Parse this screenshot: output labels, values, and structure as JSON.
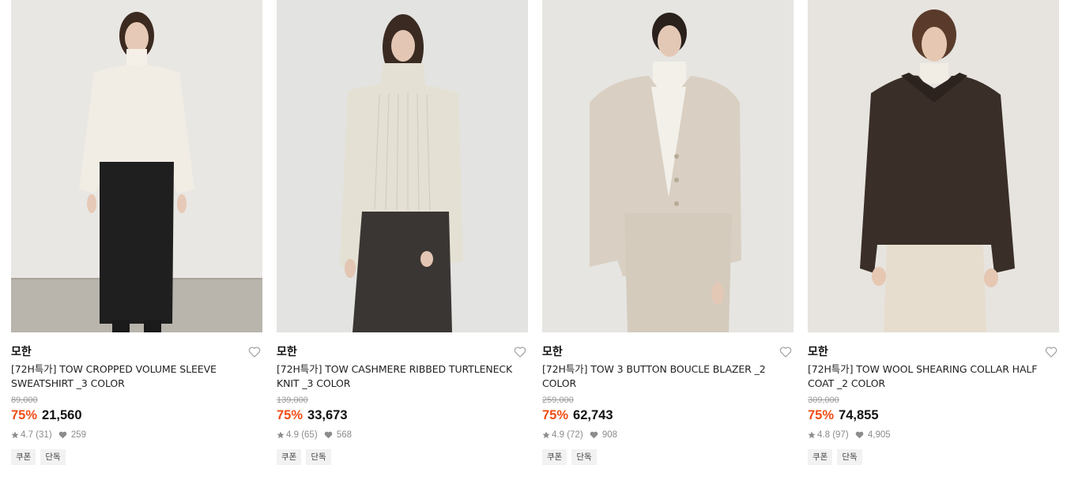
{
  "products": [
    {
      "brand": "모한",
      "title": "[72H특가] TOW CROPPED VOLUME SLEEVE SWEATSHIRT _3 COLOR",
      "original_price": "89,000",
      "discount": "75%",
      "price": "21,560",
      "rating": "4.7",
      "reviews": "(31)",
      "likes": "259",
      "tags": [
        "쿠폰",
        "단독"
      ],
      "image_palette": {
        "bg": "#e9e7e3",
        "floor": "#b9b4ac",
        "top": "#f1ede4",
        "bottom": "#1f1f1f",
        "hair": "#3c2a20",
        "skin": "#e6c9b6"
      }
    },
    {
      "brand": "모한",
      "title": "[72H특가] TOW CASHMERE RIBBED TURTLENECK KNIT _3 COLOR",
      "original_price": "139,000",
      "discount": "75%",
      "price": "33,673",
      "rating": "4.9",
      "reviews": "(65)",
      "likes": "568",
      "tags": [
        "쿠폰",
        "단독"
      ],
      "image_palette": {
        "bg": "#e3e3e1",
        "floor": "#e3e3e1",
        "top": "#e4e0d3",
        "bottom": "#3a3633",
        "hair": "#3a2a22",
        "skin": "#e3c6b3"
      }
    },
    {
      "brand": "모한",
      "title": "[72H특가] TOW 3 BUTTON BOUCLE BLAZER _2 COLOR",
      "original_price": "259,000",
      "discount": "75%",
      "price": "62,743",
      "rating": "4.9",
      "reviews": "(72)",
      "likes": "908",
      "tags": [
        "쿠폰",
        "단독"
      ],
      "image_palette": {
        "bg": "#e6e5e2",
        "floor": "#e6e5e2",
        "top": "#d9d0c3",
        "bottom": "#d4cbbd",
        "hair": "#2a211c",
        "skin": "#e4c8b6"
      }
    },
    {
      "brand": "모한",
      "title": "[72H특가] TOW WOOL SHEARING COLLAR HALF COAT _2 COLOR",
      "original_price": "309,000",
      "discount": "75%",
      "price": "74,855",
      "rating": "4.8",
      "reviews": "(97)",
      "likes": "4,905",
      "tags": [
        "쿠폰",
        "단독"
      ],
      "image_palette": {
        "bg": "#e7e4df",
        "floor": "#e7e4df",
        "top": "#3a2e28",
        "bottom": "#e6ddcf",
        "hair": "#5a3b2b",
        "skin": "#e6c7b2"
      }
    }
  ]
}
